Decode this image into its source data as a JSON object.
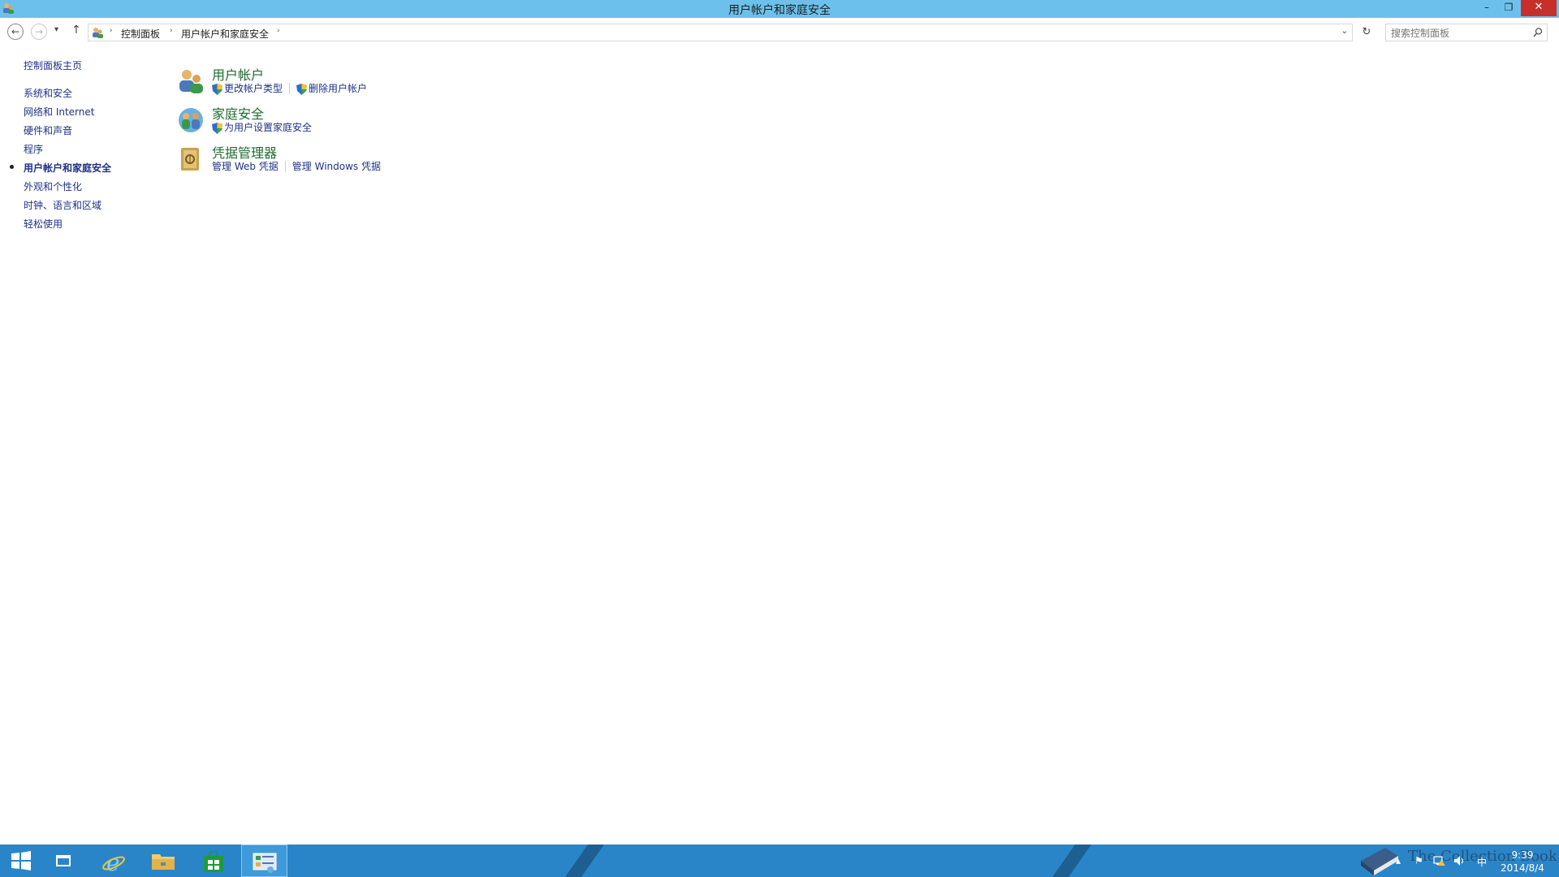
{
  "window": {
    "title": "用户帐户和家庭安全",
    "minimize_glyph": "–",
    "maximize_glyph": "❐",
    "close_glyph": "✕"
  },
  "nav": {
    "back_glyph": "←",
    "forward_glyph": "→",
    "recent_glyph": "▾",
    "up_glyph": "↑",
    "breadcrumbs": [
      {
        "label": "控制面板"
      },
      {
        "label": "用户帐户和家庭安全"
      }
    ],
    "crumb_separator": "›",
    "dropdown_glyph": "⌄",
    "refresh_glyph": "↻",
    "search_placeholder": "搜索控制面板"
  },
  "sidebar": {
    "home": "控制面板主页",
    "items": [
      {
        "label": "系统和安全",
        "active": false
      },
      {
        "label": "网络和 Internet",
        "active": false
      },
      {
        "label": "硬件和声音",
        "active": false
      },
      {
        "label": "程序",
        "active": false
      },
      {
        "label": "用户帐户和家庭安全",
        "active": true
      },
      {
        "label": "外观和个性化",
        "active": false
      },
      {
        "label": "时钟、语言和区域",
        "active": false
      },
      {
        "label": "轻松使用",
        "active": false
      }
    ]
  },
  "categories": [
    {
      "title": "用户帐户",
      "icon": "users-icon",
      "links": [
        {
          "label": "更改帐户类型",
          "shield": true
        },
        {
          "label": "删除用户帐户",
          "shield": true
        }
      ]
    },
    {
      "title": "家庭安全",
      "icon": "family-safety-icon",
      "links": [
        {
          "label": "为用户设置家庭安全",
          "shield": true
        }
      ]
    },
    {
      "title": "凭据管理器",
      "icon": "credential-vault-icon",
      "links": [
        {
          "label": "管理 Web 凭据",
          "shield": false
        },
        {
          "label": "管理 Windows 凭据",
          "shield": false
        }
      ]
    }
  ],
  "taskbar": {
    "apps": [
      {
        "name": "start",
        "icon": "windows-logo-icon"
      },
      {
        "name": "server-manager",
        "icon": "server-manager-icon"
      },
      {
        "name": "internet-explorer",
        "icon": "ie-icon"
      },
      {
        "name": "file-explorer",
        "icon": "folder-icon"
      },
      {
        "name": "store",
        "icon": "store-icon"
      },
      {
        "name": "control-panel",
        "icon": "control-panel-icon",
        "active": true
      }
    ],
    "tray": {
      "up_glyph": "▴",
      "flag_glyph": "⚑",
      "ime": "中"
    },
    "time": "9:39",
    "date": "2014/8/4"
  },
  "watermark": {
    "text": "The Collection Book"
  },
  "colors": {
    "titlebar": "#6cc1ec",
    "taskbar": "#2a85c8",
    "link": "#1e3287",
    "category_title": "#1e6b2f",
    "close": "#c7302a"
  }
}
